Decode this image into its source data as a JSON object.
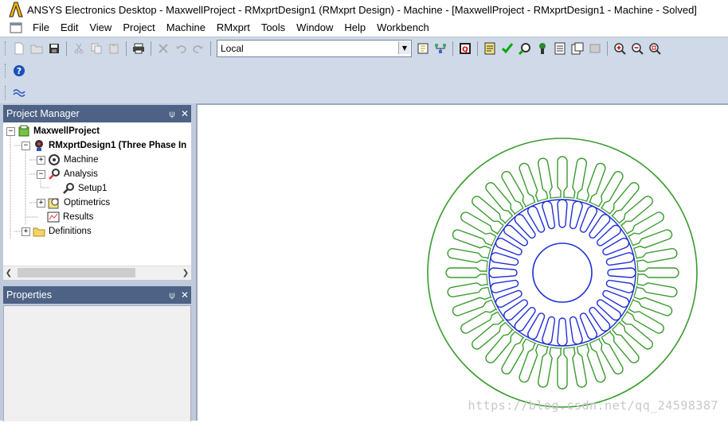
{
  "window": {
    "title": "ANSYS Electronics Desktop - MaxwellProject - RMxprtDesign1 (RMxprt Design) - Machine - [MaxwellProject - RMxprtDesign1 - Machine - Solved]"
  },
  "menu": {
    "items": [
      {
        "label": "File"
      },
      {
        "label": "Edit"
      },
      {
        "label": "View"
      },
      {
        "label": "Project"
      },
      {
        "label": "Machine"
      },
      {
        "label": "RMxprt"
      },
      {
        "label": "Tools"
      },
      {
        "label": "Window"
      },
      {
        "label": "Help"
      },
      {
        "label": "Workbench"
      }
    ]
  },
  "toolbar": {
    "analysis_target": "Local"
  },
  "project_manager": {
    "title": "Project Manager",
    "pin_glyph": "⍦",
    "close_glyph": "✕",
    "tree": [
      {
        "label": "MaxwellProject",
        "bold": true,
        "expander": "−",
        "icon": "project-icon"
      },
      {
        "label": "RMxprtDesign1 (Three Phase In",
        "bold": true,
        "expander": "−",
        "icon": "design-icon"
      },
      {
        "label": "Machine",
        "bold": false,
        "expander": "+",
        "icon": "machine-icon"
      },
      {
        "label": "Analysis",
        "bold": false,
        "expander": "−",
        "icon": "analysis-icon"
      },
      {
        "label": "Setup1",
        "bold": false,
        "expander": "",
        "icon": "setup-icon"
      },
      {
        "label": "Optimetrics",
        "bold": false,
        "expander": "+",
        "icon": "optimetrics-icon"
      },
      {
        "label": "Results",
        "bold": false,
        "expander": "",
        "icon": "results-icon"
      },
      {
        "label": "Definitions",
        "bold": false,
        "expander": "+",
        "icon": "folder-icon"
      }
    ]
  },
  "properties": {
    "title": "Properties",
    "pin_glyph": "⍦",
    "close_glyph": "✕"
  },
  "canvas": {
    "stator_color": "#3a9b2e",
    "rotor_color": "#1f2fd6",
    "stator_slots": 36,
    "rotor_slots": 28
  },
  "watermark": "https://blog.csdn.net/qq_24598387"
}
